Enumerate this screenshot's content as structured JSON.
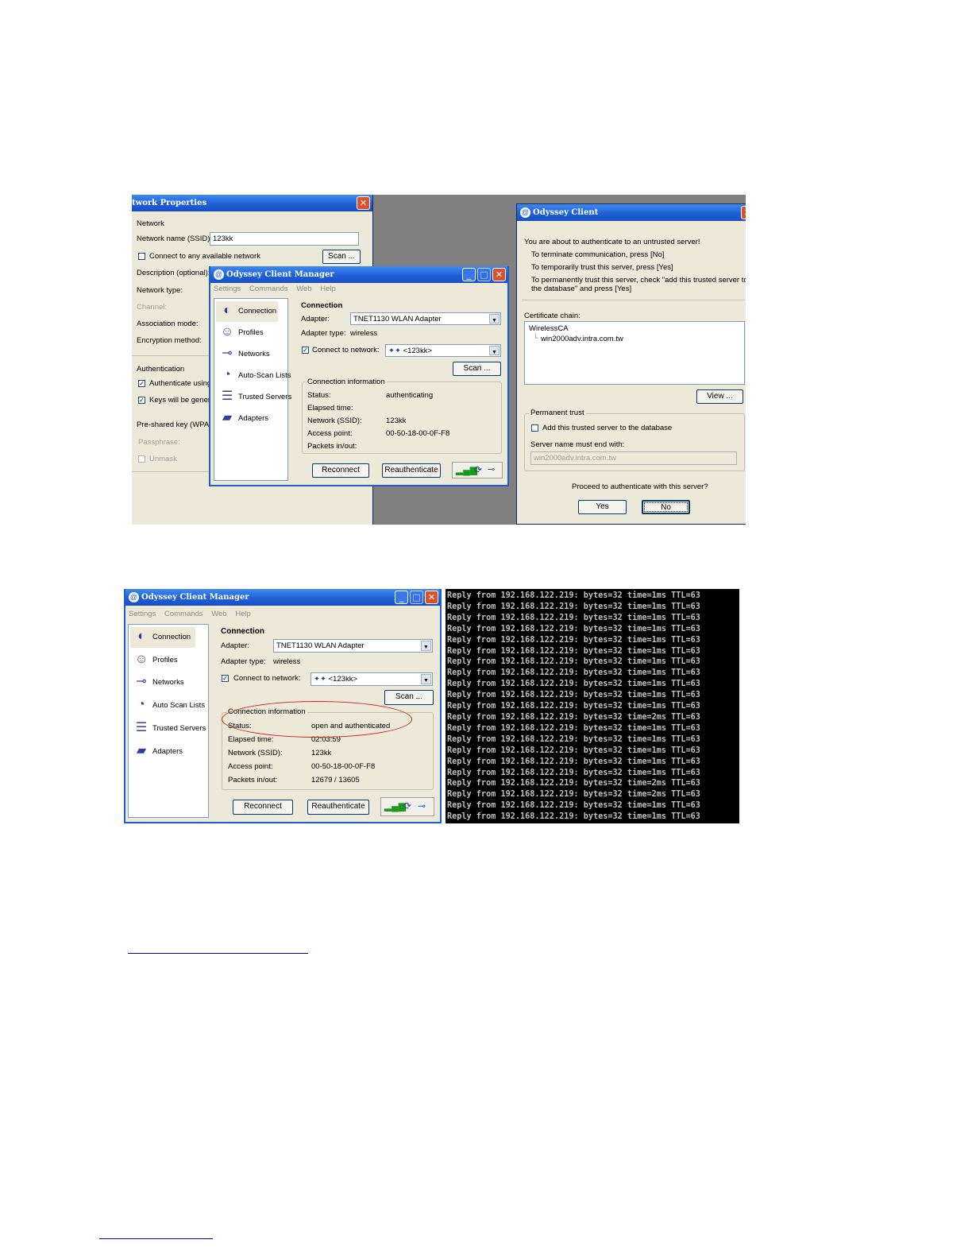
{
  "network_props": {
    "title": "twork Properties",
    "group_network": "Network",
    "ssid_label": "Network name (SSID):",
    "ssid_value": "123kk",
    "connect_any_label": "Connect to any available network",
    "scan_label": "Scan ...",
    "description_label": "Description (optional):",
    "network_type_label": "Network type:",
    "channel_label": "Channel:",
    "association_label": "Association mode:",
    "encryption_label": "Encryption method:",
    "group_auth": "Authentication",
    "auth_using_label": "Authenticate using p",
    "keys_generated_label": "Keys will be generat",
    "psk_label": "Pre-shared key (WPA)",
    "passphrase_label": "Passphrase:",
    "unmask_label": "Unmask"
  },
  "odyssey_client": {
    "title": "Odyssey Client",
    "msg1": "You are about to authenticate to an untrusted server!",
    "msg2": "To terminate communication, press [No]",
    "msg3": "To temporarily trust this server, press [Yes]",
    "msg4": "To permanently trust this server, check \"add this trusted server to",
    "msg5": "the database\" and press [Yes]",
    "cert_chain_label": "Certificate chain:",
    "cert_root": "WirelessCA",
    "cert_child": "win2000adv.intra.com.tw",
    "view_label": "View ...",
    "group_permanent": "Permanent trust",
    "add_trusted_label": "Add this trusted server to the database",
    "server_name_label": "Server name must end with:",
    "server_name_value": "win2000adv.intra.com.tw",
    "proceed_question": "Proceed to authenticate with this server?",
    "yes_label": "Yes",
    "no_label": "No"
  },
  "manager_top": {
    "title": "Odyssey Client Manager",
    "menu": [
      "Settings",
      "Commands",
      "Web",
      "Help"
    ],
    "nav": [
      "Connection",
      "Profiles",
      "Networks",
      "Auto-Scan Lists",
      "Trusted Servers",
      "Adapters"
    ],
    "section_title": "Connection",
    "adapter_label": "Adapter:",
    "adapter_value": "TNET1130 WLAN Adapter",
    "adapter_type_label": "Adapter type:",
    "adapter_type_value": "wireless",
    "connect_label": "Connect to network:",
    "connect_value": "<123kk>",
    "scan_label": "Scan ...",
    "info_group": "Connection information",
    "status_label": "Status:",
    "status_value": "authenticating",
    "elapsed_label": "Elapsed time:",
    "elapsed_value": "",
    "ssid_label": "Network (SSID):",
    "ssid_value": "123kk",
    "ap_label": "Access point:",
    "ap_value": "00-50-18-00-0F-F8",
    "packets_label": "Packets in/out:",
    "packets_value": "",
    "reconnect_label": "Reconnect",
    "reauth_label": "Reauthenticate"
  },
  "manager_bottom": {
    "title": "Odyssey Client Manager",
    "menu": [
      "Settings",
      "Commands",
      "Web",
      "Help"
    ],
    "nav": [
      "Connection",
      "Profiles",
      "Networks",
      "Auto Scan Lists",
      "Trusted Servers",
      "Adapters"
    ],
    "section_title": "Connection",
    "adapter_label": "Adapter:",
    "adapter_value": "TNET1130 WLAN Adapter",
    "adapter_type_label": "Adapter type:",
    "adapter_type_value": "wireless",
    "connect_label": "Connect to network:",
    "connect_value": "<123kk>",
    "scan_label": "Scan ...",
    "info_group": "Connection information",
    "status_label": "Status:",
    "status_value": "open and authenticated",
    "elapsed_label": "Elapsed time:",
    "elapsed_value": "02:03:59",
    "ssid_label": "Network (SSID):",
    "ssid_value": "123kk",
    "ap_label": "Access point:",
    "ap_value": "00-50-18-00-0F-F8",
    "packets_label": "Packets in/out:",
    "packets_value": "12679 / 13605",
    "reconnect_label": "Reconnect",
    "reauth_label": "Reauthenticate"
  },
  "terminal": {
    "lines": [
      "Reply from 192.168.122.219: bytes=32 time=1ms TTL=63",
      "Reply from 192.168.122.219: bytes=32 time=1ms TTL=63",
      "Reply from 192.168.122.219: bytes=32 time=1ms TTL=63",
      "Reply from 192.168.122.219: bytes=32 time=1ms TTL=63",
      "Reply from 192.168.122.219: bytes=32 time=1ms TTL=63",
      "Reply from 192.168.122.219: bytes=32 time=1ms TTL=63",
      "Reply from 192.168.122.219: bytes=32 time=1ms TTL=63",
      "Reply from 192.168.122.219: bytes=32 time=1ms TTL=63",
      "Reply from 192.168.122.219: bytes=32 time=1ms TTL=63",
      "Reply from 192.168.122.219: bytes=32 time=1ms TTL=63",
      "Reply from 192.168.122.219: bytes=32 time=1ms TTL=63",
      "Reply from 192.168.122.219: bytes=32 time=2ms TTL=63",
      "Reply from 192.168.122.219: bytes=32 time=1ms TTL=63",
      "Reply from 192.168.122.219: bytes=32 time=1ms TTL=63",
      "Reply from 192.168.122.219: bytes=32 time=1ms TTL=63",
      "Reply from 192.168.122.219: bytes=32 time=1ms TTL=63",
      "Reply from 192.168.122.219: bytes=32 time=1ms TTL=63",
      "Reply from 192.168.122.219: bytes=32 time=2ms TTL=63",
      "Reply from 192.168.122.219: bytes=32 time=2ms TTL=63",
      "Reply from 192.168.122.219: bytes=32 time=1ms TTL=63",
      "Reply from 192.168.122.219: bytes=32 time=1ms TTL=63"
    ]
  },
  "colors": {
    "xp_title": "#1f5fd6",
    "window_bg": "#ece9d8",
    "highlight_oval": "#cc2222",
    "terminal_bg": "#000000"
  }
}
